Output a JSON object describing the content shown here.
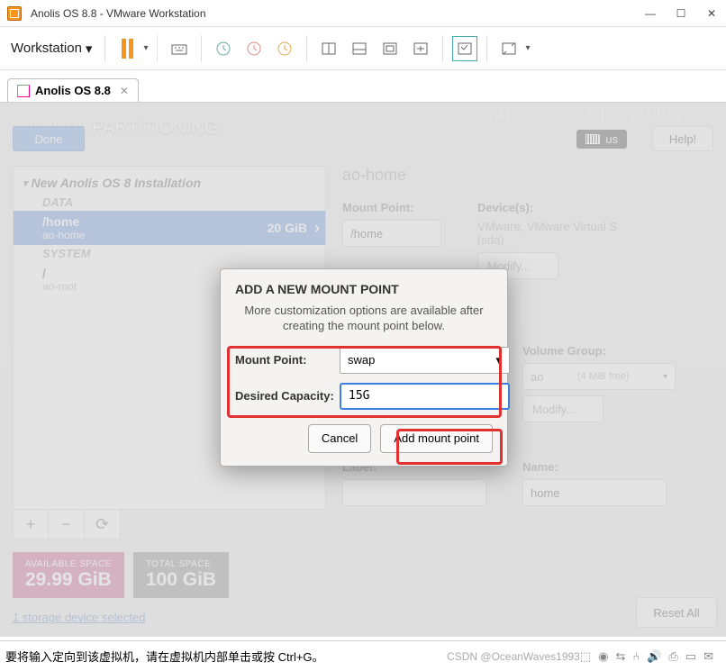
{
  "window": {
    "title": "Anolis OS 8.8 - VMware Workstation",
    "menu_label": "Workstation",
    "tab_label": "Anolis OS 8.8"
  },
  "installer": {
    "header_title": "MANUAL PARTITIONING",
    "brand_title": "ANOLIS OS 8 INSTALLATION",
    "done_label": "Done",
    "help_label": "Help!",
    "keyboard_layout": "us",
    "tree": {
      "install_name": "New Anolis OS 8 Installation",
      "sections": [
        {
          "label": "DATA",
          "rows": [
            {
              "mount": "/home",
              "device": "ao-home",
              "size": "20 GiB",
              "selected": true
            }
          ]
        },
        {
          "label": "SYSTEM",
          "rows": [
            {
              "mount": "/",
              "device": "ao-root",
              "size": "",
              "selected": false
            }
          ]
        }
      ]
    },
    "space": {
      "available_label": "AVAILABLE SPACE",
      "available_value": "29.99 GiB",
      "total_label": "TOTAL SPACE",
      "total_value": "100 GiB"
    },
    "storage_selected": "1 storage device selected",
    "reset_label": "Reset All",
    "details": {
      "device_name": "ao-home",
      "mount_label": "Mount Point:",
      "mount_value": "/home",
      "devices_label": "Device(s):",
      "devices_value": "VMware, VMware Virtual S (sda)",
      "modify_label": "Modify...",
      "vg_label": "Volume Group:",
      "vg_name": "ao",
      "vg_free": "(4 MiB free)",
      "label_label": "Label:",
      "label_value": "",
      "name_label": "Name:",
      "name_value": "home"
    }
  },
  "dialog": {
    "title": "ADD A NEW MOUNT POINT",
    "subtitle": "More customization options are available after creating the mount point below.",
    "mount_label": "Mount Point:",
    "mount_value": "swap",
    "capacity_label": "Desired Capacity:",
    "capacity_value": "15G",
    "cancel_label": "Cancel",
    "add_label": "Add mount point"
  },
  "statusbar": {
    "hint": "要将输入定向到该虚拟机，请在虚拟机内部单击或按 Ctrl+G。",
    "watermark": "CSDN @OceanWaves1993"
  }
}
